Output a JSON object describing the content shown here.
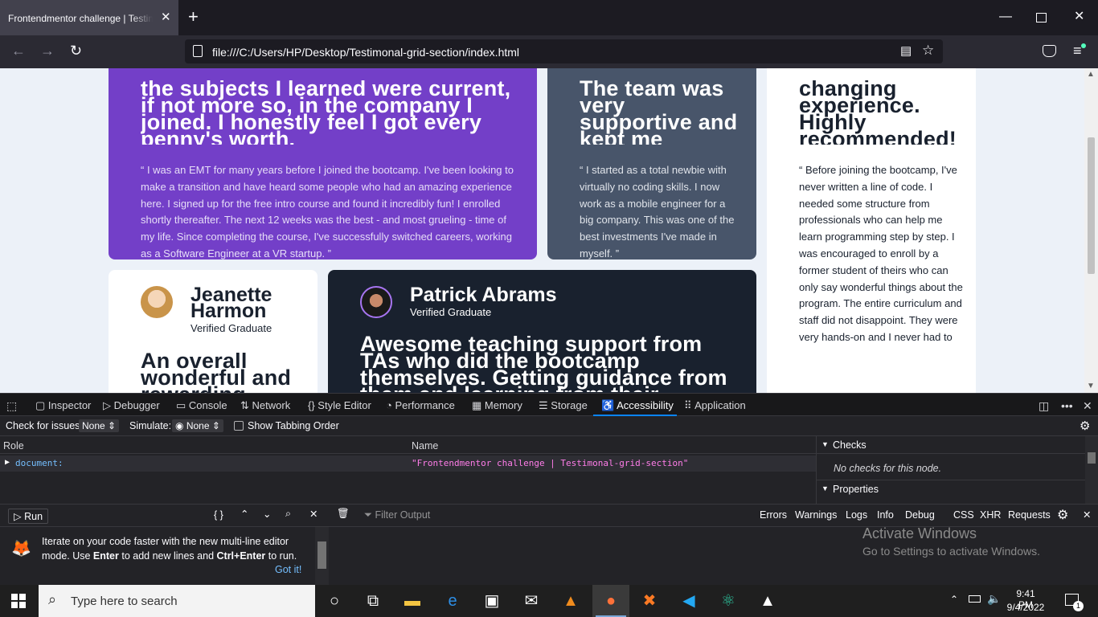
{
  "browser": {
    "tab_title": "Frontendmentor challenge | Testimonial-grid-section",
    "url": "file:///C:/Users/HP/Desktop/Testimonal-grid-section/index.html"
  },
  "page": {
    "card1": {
      "headline": "the subjects I learned were current, if not more so, in the company I joined. I honestly feel I got every penny's worth.",
      "quote": "“ I was an EMT for many years before I joined the bootcamp. I've been looking to make a transition and have heard some people who had an amazing experience here. I signed up for the free intro course and found it incredibly fun! I enrolled shortly thereafter. The next 12 weeks was the best - and most grueling - time of my life. Since completing the course, I've successfully switched careers, working as a Software Engineer at a VR startup. ”"
    },
    "card2": {
      "headline": "The team was very supportive and kept me motivated",
      "quote": "“ I started as a total newbie with virtually no coding skills. I now work as a mobile engineer for a big company. This was one of the best investments I've made in myself. ”"
    },
    "card3": {
      "headline": "changing experience. Highly recommended!",
      "quote": "“ Before joining the bootcamp, I've never written a line of code. I needed some structure from professionals who can help me learn programming step by step. I was encouraged to enroll by a former student of theirs who can only say wonderful things about the program. The entire curriculum and staff did not disappoint. They were very hands-on and I never had to wait long for assistance. The agile team project, in particular, was outstanding. It took my learning to the next level in a"
    },
    "card4": {
      "name_line1": "Jeanette",
      "name_line2": "Harmon",
      "role": "Verified Graduate",
      "headline": "An overall wonderful and rewarding"
    },
    "card5": {
      "name": "Patrick Abrams",
      "role": "Verified Graduate",
      "headline": "Awesome teaching support from TAs who did the bootcamp themselves. Getting guidance from them and learning from their experiences was"
    }
  },
  "devtools": {
    "tabs": [
      "Inspector",
      "Debugger",
      "Console",
      "Network",
      "Style Editor",
      "Performance",
      "Memory",
      "Storage",
      "Accessibility",
      "Application"
    ],
    "active_tab": "Accessibility",
    "check_label": "Check for issues:",
    "check_value": "None",
    "simulate_label": "Simulate:",
    "simulate_value": "None",
    "tabbing_label": "Show Tabbing Order",
    "col_role": "Role",
    "col_name": "Name",
    "row_role": "document:",
    "row_name": "\"Frontendmentor challenge | Testimonal-grid-section\"",
    "checks_title": "Checks",
    "checks_empty": "No checks for this node.",
    "properties_title": "Properties",
    "run_label": "Run",
    "braces": "{ }",
    "filter_placeholder": "Filter Output",
    "filters": [
      "Errors",
      "Warnings",
      "Logs",
      "Info",
      "Debug",
      "CSS",
      "XHR",
      "Requests"
    ],
    "notice_part1": "Iterate on your code faster with the new multi-line editor mode. Use ",
    "notice_enter": "Enter",
    "notice_part2": " to add new lines and ",
    "notice_ctrl": "Ctrl+Enter",
    "notice_part3": " to run.",
    "notice_button": "Got it!"
  },
  "watermark": {
    "line1": "Activate Windows",
    "line2": "Go to Settings to activate Windows."
  },
  "taskbar": {
    "search_placeholder": "Type here to search",
    "time": "9:41 PM",
    "date": "9/4/2022",
    "notif_count": "1"
  },
  "colors": {
    "purple": "#733fc8",
    "slate": "#48556a",
    "dark": "#19212e",
    "page_bg": "#ecf1f8"
  }
}
